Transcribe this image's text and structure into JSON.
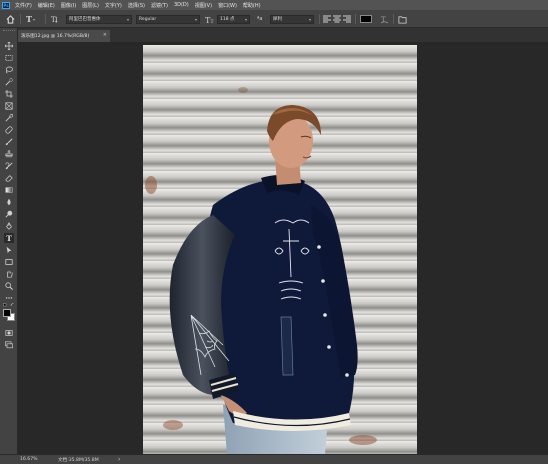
{
  "menu": [
    "文件(F)",
    "编辑(E)",
    "图像(I)",
    "图层(L)",
    "文字(Y)",
    "选择(S)",
    "滤镜(T)",
    "3D(D)",
    "视图(V)",
    "窗口(W)",
    "帮助(H)"
  ],
  "app_logo": "Ps",
  "options": {
    "font_family": "阿里巴巴普惠体",
    "font_style": "Regular",
    "font_size": "118 点",
    "anti_alias": "犀利",
    "color_swatch": "#000000"
  },
  "document": {
    "tab_label": "滚乐图12.jpg @ 16.7%(RGB/8)",
    "close_glyph": "×"
  },
  "status": {
    "zoom": "16.67%",
    "doc_info": "文档:35.8M/35.8M",
    "arrow": "›"
  },
  "icons": {
    "home": "home-icon",
    "type_tool": "type-tool-icon",
    "orientation": "text-orientation-icon",
    "font_size": "font-size-icon",
    "antialias": "antialias-icon",
    "align": "align-icons",
    "warp": "warp-text-icon",
    "panels": "character-panel-icon"
  },
  "colors": {
    "foreground": "#000000",
    "background": "#ffffff",
    "accent": "#31a8ff"
  }
}
